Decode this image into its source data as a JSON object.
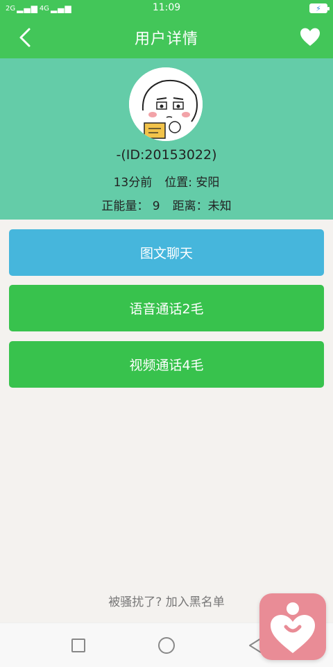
{
  "status_bar": {
    "network_left": "2G",
    "network_right": "4G",
    "time": "11:09"
  },
  "header": {
    "title": "用户详情"
  },
  "profile": {
    "id_text": "-(ID:20153022)",
    "last_seen": "13分前",
    "location": "位置: 安阳",
    "energy": "正能量： 9",
    "distance": "距离：未知"
  },
  "actions": {
    "chat_label": "图文聊天",
    "voice_label": "语音通话2毛",
    "video_label": "视频通话4毛"
  },
  "footer": {
    "block_label": "被骚扰了? 加入黑名单"
  },
  "colors": {
    "primary": "#43c659",
    "profile_bg": "#64cca8",
    "chat_btn": "#46b6dc",
    "call_btn": "#38c24d",
    "widget": "#e98c96"
  }
}
